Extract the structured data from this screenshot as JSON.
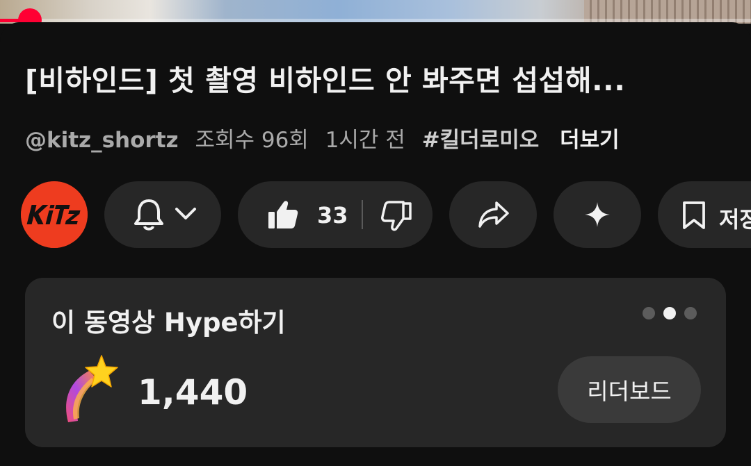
{
  "video": {
    "title": "[비하인드] 첫 촬영 비하인드 안 봐주면 섭섭해...",
    "progress_fraction": 0.04
  },
  "meta": {
    "channel": "@kitz_shortz",
    "views": "조회수 96회",
    "time": "1시간 전",
    "hashtag": "#킬더로미오",
    "more": "더보기"
  },
  "channel_avatar": {
    "logo_text": "KiTZ",
    "color": "#ee3c1f"
  },
  "actions": {
    "like_count": "33",
    "save_label": "저장",
    "icons": [
      "bell-icon",
      "chevron-down-icon",
      "thumbs-up-icon",
      "thumbs-down-icon",
      "share-icon",
      "sparkle-icon",
      "bookmark-icon"
    ]
  },
  "hype": {
    "title": "이 동영상 Hype하기",
    "count": "1,440",
    "leaderboard_label": "리더보드",
    "page_indicator": {
      "total": 3,
      "active": 2
    }
  },
  "colors": {
    "accent": "#ff0033",
    "background": "#0f0f0f",
    "surface": "#272727"
  }
}
